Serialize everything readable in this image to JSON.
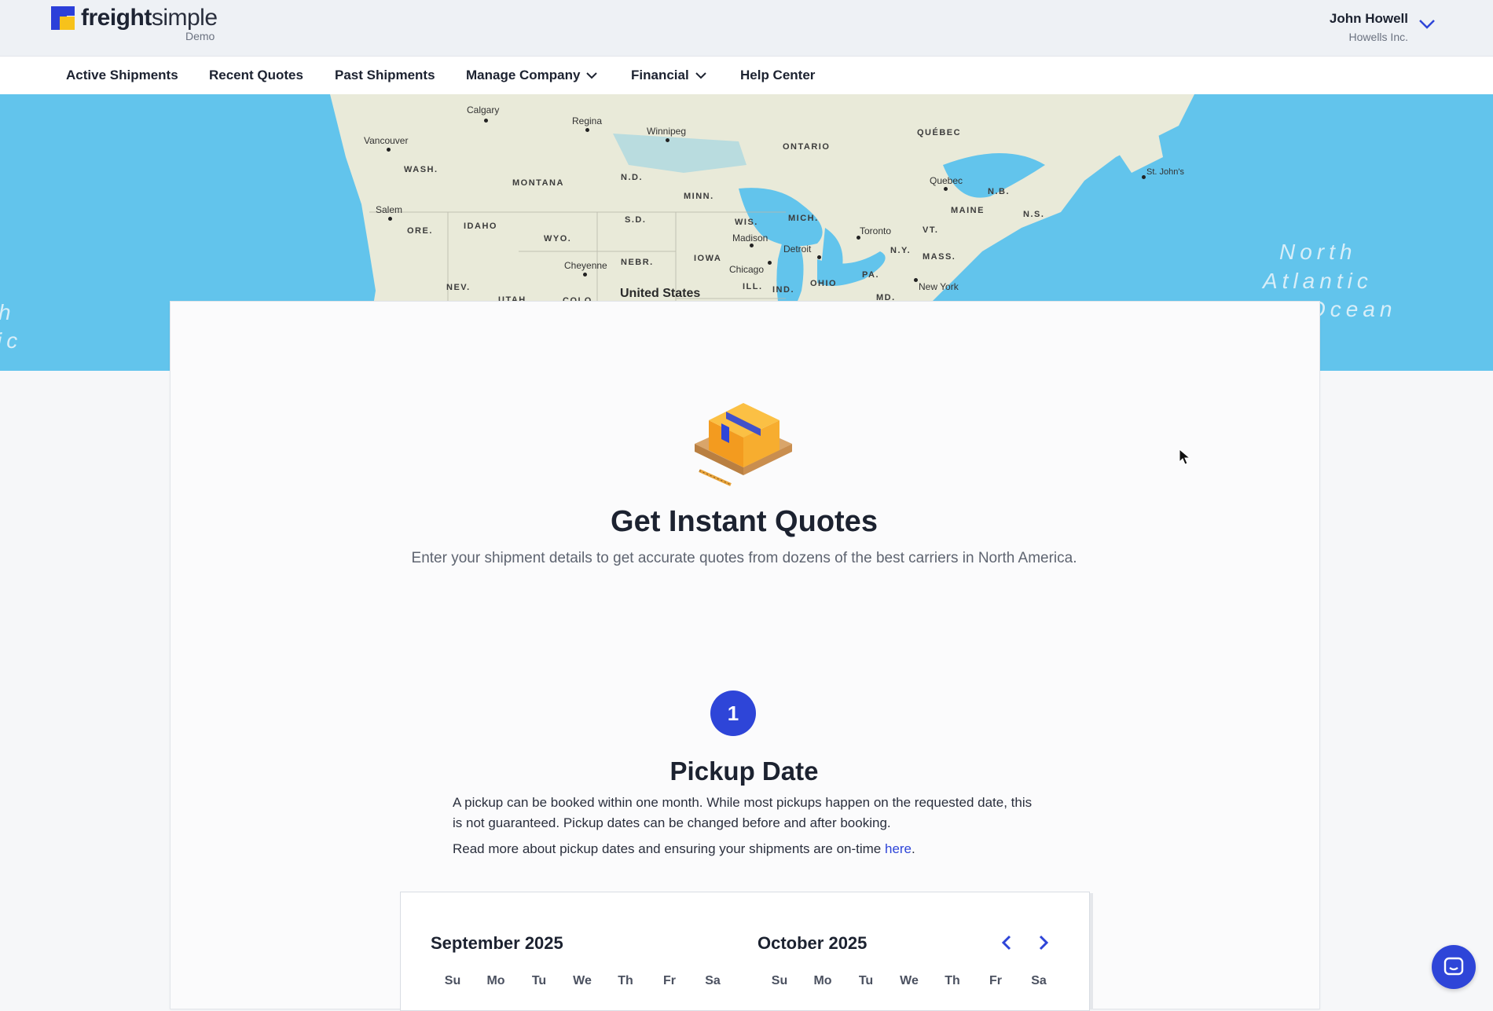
{
  "header": {
    "logo": {
      "bold": "freight",
      "light": "simple",
      "sub": "Demo"
    },
    "user": {
      "name": "John Howell",
      "company": "Howells Inc."
    }
  },
  "nav": {
    "items": [
      {
        "label": "Active Shipments",
        "has_dropdown": false
      },
      {
        "label": "Recent Quotes",
        "has_dropdown": false
      },
      {
        "label": "Past Shipments",
        "has_dropdown": false
      },
      {
        "label": "Manage Company",
        "has_dropdown": true
      },
      {
        "label": "Financial",
        "has_dropdown": true
      },
      {
        "label": "Help Center",
        "has_dropdown": false
      }
    ]
  },
  "map": {
    "regions": [
      "QUÉBEC",
      "ONTARIO",
      "WASH.",
      "MONTANA",
      "N.D.",
      "MINN.",
      "S.D.",
      "IDAHO",
      "ORE.",
      "WYO.",
      "NEBR.",
      "IOWA",
      "WIS.",
      "MICH.",
      "MAINE",
      "N.B.",
      "N.S.",
      "VT.",
      "N.Y.",
      "MASS.",
      "PA.",
      "OHIO",
      "IND.",
      "ILL.",
      "NEV.",
      "UTAH",
      "COLO.",
      "MD."
    ],
    "cities": [
      "Calgary",
      "Regina",
      "Winnipeg",
      "Vancouver",
      "Salem",
      "Cheyenne",
      "Madison",
      "Chicago",
      "Detroit",
      "Toronto",
      "Quebec",
      "St. John's",
      "New York"
    ],
    "country": "United States",
    "ocean": [
      "North",
      "Atlantic",
      "Ocean"
    ],
    "ocean_left": [
      "h",
      "ic"
    ]
  },
  "hero": {
    "title": "Get Instant Quotes",
    "subtitle": "Enter your shipment details to get accurate quotes from dozens of the best carriers in North America."
  },
  "step": {
    "number": "1",
    "title": "Pickup Date",
    "description": "A pickup can be booked within one month. While most pickups happen on the requested date, this is not guaranteed. Pickup dates can be changed before and after booking.",
    "more_text": "Read more about pickup dates and ensuring your shipments are on-time ",
    "more_link": "here",
    "more_end": "."
  },
  "calendar": {
    "months": [
      "September 2025",
      "October 2025"
    ],
    "weekdays": [
      "Su",
      "Mo",
      "Tu",
      "We",
      "Th",
      "Fr",
      "Sa"
    ]
  },
  "colors": {
    "brand": "#2e45d8",
    "accent": "#f7c21b",
    "water": "#62c4ec",
    "land": "#e9ead9"
  },
  "icons": {
    "user_menu": "chevron-down-icon",
    "chat": "chat-icon",
    "prev": "chevron-left-icon",
    "next": "chevron-right-icon"
  }
}
